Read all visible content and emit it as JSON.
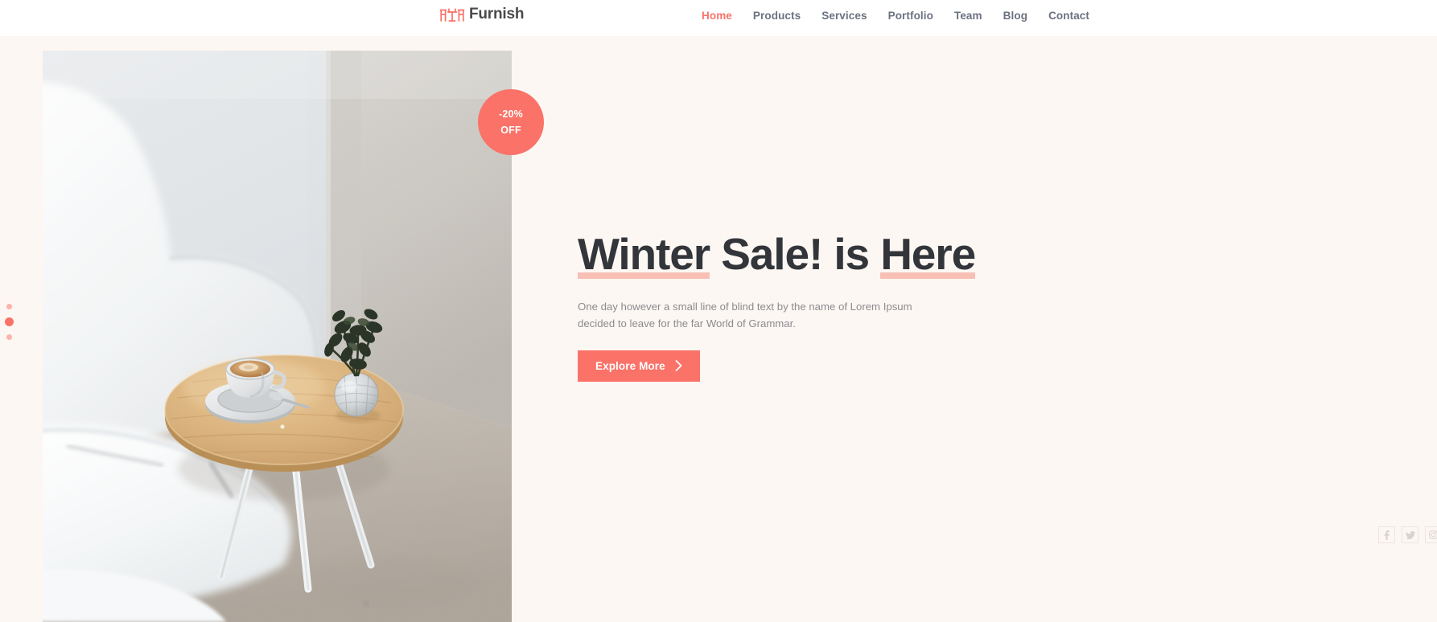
{
  "header": {
    "brand": {
      "icon": "table-chairs-icon",
      "name": "Furnish"
    },
    "nav": [
      {
        "label": "Home",
        "active": true
      },
      {
        "label": "Products",
        "active": false
      },
      {
        "label": "Services",
        "active": false
      },
      {
        "label": "Portfolio",
        "active": false
      },
      {
        "label": "Team",
        "active": false
      },
      {
        "label": "Blog",
        "active": false
      },
      {
        "label": "Contact",
        "active": false
      }
    ]
  },
  "hero": {
    "badge": {
      "percent": "-20%",
      "label": "OFF"
    },
    "title_part1": "Winter",
    "title_part2": " Sale! is ",
    "title_part3": "Here",
    "description": "One day however a small line of blind text by the name of Lorem Ipsum decided to leave for the far World of Grammar.",
    "cta": {
      "label": "Explore More",
      "icon": "chevron-right-icon"
    },
    "image_alt": "white chairs and round wooden side table with coffee cup and plant"
  },
  "slider": {
    "dots": [
      {
        "name": "slide-1",
        "active": false
      },
      {
        "name": "slide-2",
        "active": true
      },
      {
        "name": "slide-3",
        "active": false
      }
    ]
  },
  "social": [
    {
      "name": "facebook-icon",
      "label": "Facebook"
    },
    {
      "name": "twitter-icon",
      "label": "Twitter"
    },
    {
      "name": "instagram-icon",
      "label": "Instagram"
    }
  ],
  "colors": {
    "accent": "#fa7268",
    "accent_light": "#f8c0b5",
    "page_bg": "#fdf7f3",
    "header_bg": "#ffffff",
    "heading": "#32353a",
    "nav_text": "#6b7280",
    "body_text": "#8b8b90",
    "social_border": "#ece6e2"
  }
}
